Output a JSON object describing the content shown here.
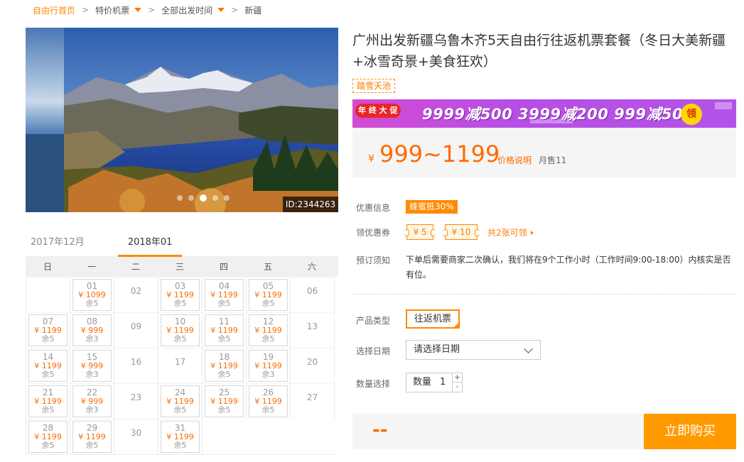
{
  "breadcrumb": {
    "items": [
      "自由行首页",
      "特价机票",
      "全部出发时间",
      "新疆"
    ],
    "separator": ">"
  },
  "gallery": {
    "image_id": "ID:2344263",
    "dots_total": 5,
    "active_dot": 2
  },
  "product": {
    "title": "广州出发新疆乌鲁木齐5天自由行往返机票套餐（冬日大美新疆+冰雪奇景+美食狂欢）",
    "tag": "踏雪天池"
  },
  "banner": {
    "badge": "年 终 大 促",
    "text": "9999减500  3999减200  999减50",
    "claim": "领"
  },
  "price": {
    "currency": "¥",
    "range": "999~1199",
    "note": "价格说明",
    "sold": "月售11"
  },
  "offers": {
    "discount_label": "优惠信息",
    "discount_badge": "蜂蜜抵30%",
    "coupon_label": "领优惠券",
    "coupons": [
      "¥ 5",
      "¥ 10"
    ],
    "coupon_count": "共2张可领",
    "notice_label": "预订须知",
    "notice": "下单后需要商家二次确认，我们将在9个工作小时（工作时间9:00-18:00）内核实是否有位。"
  },
  "options": {
    "type_label": "产品类型",
    "type_value": "往返机票",
    "date_label": "选择日期",
    "date_placeholder": "请选择日期",
    "qty_label": "数量选择",
    "qty_text": "数量",
    "qty_value": "1",
    "plus": "+",
    "minus": "-"
  },
  "buy": {
    "total": "--",
    "button": "立即购买"
  },
  "calendar": {
    "months": [
      "2017年12月",
      "2018年01月"
    ],
    "active_month": 1,
    "weekdays": [
      "日",
      "一",
      "二",
      "三",
      "四",
      "五",
      "六"
    ],
    "days": [
      {
        "d": "",
        "p": "",
        "s": ""
      },
      {
        "d": "01",
        "p": "¥ 1099",
        "s": "余5"
      },
      {
        "d": "02",
        "p": "",
        "s": ""
      },
      {
        "d": "03",
        "p": "¥ 1199",
        "s": "余5"
      },
      {
        "d": "04",
        "p": "¥ 1199",
        "s": "余5"
      },
      {
        "d": "05",
        "p": "¥ 1199",
        "s": "余5"
      },
      {
        "d": "06",
        "p": "",
        "s": ""
      },
      {
        "d": "07",
        "p": "¥ 1199",
        "s": "余5"
      },
      {
        "d": "08",
        "p": "¥ 999",
        "s": "余3"
      },
      {
        "d": "09",
        "p": "",
        "s": ""
      },
      {
        "d": "10",
        "p": "¥ 1199",
        "s": "余5"
      },
      {
        "d": "11",
        "p": "¥ 1199",
        "s": "余5"
      },
      {
        "d": "12",
        "p": "¥ 1199",
        "s": "余5"
      },
      {
        "d": "13",
        "p": "",
        "s": ""
      },
      {
        "d": "14",
        "p": "¥ 1199",
        "s": "余5"
      },
      {
        "d": "15",
        "p": "¥ 999",
        "s": "余3"
      },
      {
        "d": "16",
        "p": "",
        "s": ""
      },
      {
        "d": "17",
        "p": "",
        "s": ""
      },
      {
        "d": "18",
        "p": "¥ 1199",
        "s": "余5"
      },
      {
        "d": "19",
        "p": "¥ 1199",
        "s": "余3"
      },
      {
        "d": "20",
        "p": "",
        "s": ""
      },
      {
        "d": "21",
        "p": "¥ 1199",
        "s": "余5"
      },
      {
        "d": "22",
        "p": "¥ 999",
        "s": "余3"
      },
      {
        "d": "23",
        "p": "",
        "s": ""
      },
      {
        "d": "24",
        "p": "¥ 1199",
        "s": "余5"
      },
      {
        "d": "25",
        "p": "¥ 1199",
        "s": "余5"
      },
      {
        "d": "26",
        "p": "¥ 1199",
        "s": "余5"
      },
      {
        "d": "27",
        "p": "",
        "s": ""
      },
      {
        "d": "28",
        "p": "¥ 1199",
        "s": "余5"
      },
      {
        "d": "29",
        "p": "¥ 1199",
        "s": "余5"
      },
      {
        "d": "30",
        "p": "",
        "s": ""
      },
      {
        "d": "31",
        "p": "¥ 1199",
        "s": "余5"
      }
    ]
  }
}
